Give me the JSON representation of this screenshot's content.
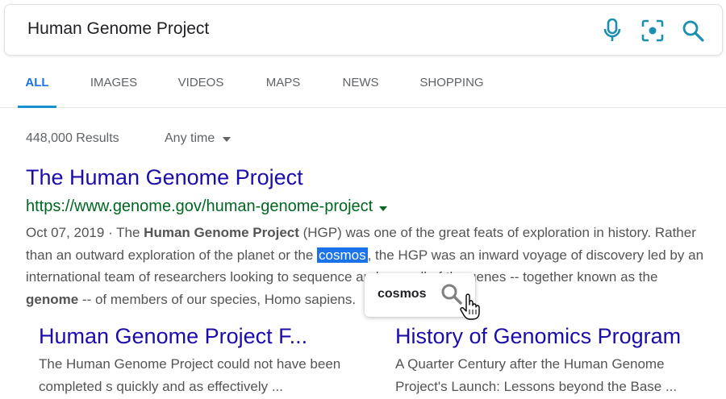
{
  "search": {
    "query": "Human Genome Project"
  },
  "icons": {
    "mic": "microphone-icon",
    "lens": "camera-lens-icon",
    "search": "search-icon"
  },
  "tabs": [
    {
      "label": "ALL",
      "active": true
    },
    {
      "label": "IMAGES"
    },
    {
      "label": "VIDEOS"
    },
    {
      "label": "MAPS"
    },
    {
      "label": "NEWS"
    },
    {
      "label": "SHOPPING"
    }
  ],
  "results_meta": {
    "count": "448,000 Results",
    "time_filter": "Any time"
  },
  "result": {
    "title": "The Human Genome Project",
    "url": "https://www.genome.gov/human-genome-project",
    "date_prefix": "Oct 07, 2019 · The ",
    "bold1": "Human Genome Project",
    "text1": " (HGP) was one of the great feats of exploration in history. Rather than an outward exploration of the planet or the ",
    "highlight": "cosmos",
    "text2": ", the HGP was an inward voyage of discovery led by an international team of researchers looking to sequence and map all of the genes -- together known as the ",
    "bold2": "genome",
    "text3": " -- of members of our species, Homo sapiens."
  },
  "popup": {
    "word": "cosmos"
  },
  "sublinks": [
    {
      "title": "Human Genome Project F...",
      "snippet": "The Human Genome Project could not have been completed s quickly and as effectively ..."
    },
    {
      "title": "History of Genomics Program",
      "snippet": "A Quarter Century after the Human Genome Project's Launch: Lessons beyond the Base ..."
    }
  ],
  "colors": {
    "link": "#1a0dab",
    "url": "#006621",
    "accent": "#1a73e8",
    "icon": "#1a8fb0"
  }
}
